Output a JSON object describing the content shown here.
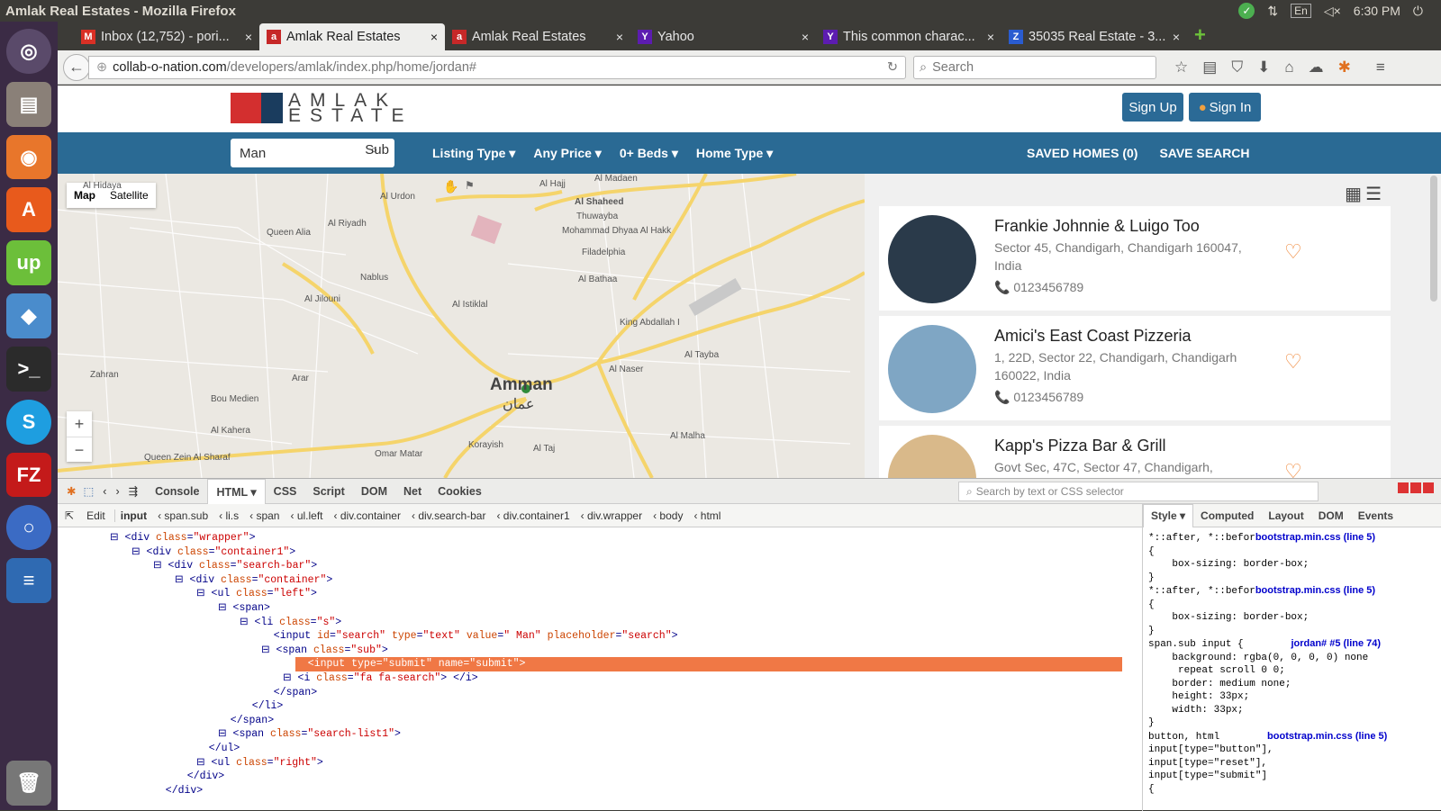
{
  "window": {
    "title": "Amlak Real Estates - Mozilla Firefox",
    "lang": "En",
    "time": "6:30 PM"
  },
  "tabs": [
    {
      "label": "Inbox (12,752) - pori...",
      "icon": "gmail-icon",
      "active": false
    },
    {
      "label": "Amlak Real Estates",
      "icon": "amlak-icon",
      "active": true
    },
    {
      "label": "Amlak Real Estates",
      "icon": "amlak-icon",
      "active": false
    },
    {
      "label": "Yahoo",
      "icon": "yahoo-icon",
      "active": false
    },
    {
      "label": "This common charac...",
      "icon": "yahoo-icon",
      "active": false
    },
    {
      "label": "35035 Real Estate - 3...",
      "icon": "site-icon",
      "active": false
    }
  ],
  "url": {
    "host": "collab-o-nation.com",
    "path": "/developers/amlak/index.php/home/jordan#"
  },
  "search_placeholder": "Search",
  "site": {
    "logo_top": "AMLAK",
    "logo_bottom": "ESTATE",
    "signup": "Sign Up",
    "signin": "Sign In",
    "search_value": "Man",
    "search_sub": "Sub",
    "filters": [
      "Listing Type",
      "Any Price",
      "0+ Beds",
      "Home Type"
    ],
    "saved_homes": "SAVED HOMES (0)",
    "save_search": "SAVE SEARCH"
  },
  "map": {
    "type_map": "Map",
    "type_satellite": "Satellite",
    "city": "Amman",
    "city_ar": "عمان",
    "labels": [
      "Al Hidaya",
      "Queen Alia",
      "Al Riyadh",
      "Al Urdon",
      "Al Hajj",
      "Al Madaen",
      "Al Shaheed",
      "Thuwayba",
      "Mohammad Dhyaa Al Hakk",
      "Filadelphia",
      "Al Bathaa",
      "Al Istiklal",
      "King Abdallah I",
      "Nablus",
      "Al Jilouni",
      "Zahran",
      "Arar",
      "Bou Medien",
      "Al Kahera",
      "Omar Matar",
      "Queen Zein Al Sharaf",
      "Al Naser",
      "Al Tayba",
      "Korayish",
      "Al Taj",
      "Al Malha"
    ]
  },
  "listings": [
    {
      "name": "Frankie Johnnie & Luigo Too",
      "address": "Sector 45, Chandigarh, Chandigarh 160047, India",
      "phone": "0123456789",
      "img": "#2a3a4a"
    },
    {
      "name": "Amici's East Coast Pizzeria",
      "address": "1, 22D, Sector 22, Chandigarh, Chandigarh 160022, India",
      "phone": "0123456789",
      "img": "#7fa6c4"
    },
    {
      "name": "Kapp's Pizza Bar & Grill",
      "address": "Govt Sec, 47C, Sector 47, Chandigarh,",
      "phone": "",
      "img": "#d9b98a"
    }
  ],
  "devtools": {
    "tabs": [
      "Console",
      "HTML",
      "CSS",
      "Script",
      "DOM",
      "Net",
      "Cookies"
    ],
    "search_placeholder": "Search by text or CSS selector",
    "edit": "Edit",
    "breadcrumbs": [
      "input",
      "span.sub",
      "li.s",
      "span",
      "ul.left",
      "div.container",
      "div.search-bar",
      "div.container1",
      "div.wrapper",
      "body",
      "html"
    ],
    "side_tabs": [
      "Style",
      "Computed",
      "Layout",
      "DOM",
      "Events"
    ],
    "tree": [
      {
        "indent": 0,
        "t": "<div class=\"wrapper\">"
      },
      {
        "indent": 1,
        "t": "<div class=\"container1\">"
      },
      {
        "indent": 2,
        "t": "<div class=\"search-bar\">"
      },
      {
        "indent": 3,
        "t": "<div class=\"container\">"
      },
      {
        "indent": 4,
        "t": "<ul class=\"left\">"
      },
      {
        "indent": 5,
        "t": "<span>"
      },
      {
        "indent": 6,
        "t": "<li class=\"s\">"
      },
      {
        "indent": 7,
        "t": "<input id=\"search\" type=\"text\" value=\" Man\" placeholder=\"search\">"
      },
      {
        "indent": 7,
        "t": "<span class=\"sub\">"
      },
      {
        "indent": 8,
        "t": "<input type=\"submit\" name=\"submit\">",
        "hl": true
      },
      {
        "indent": 8,
        "t": "<i class=\"fa fa-search\"> </i>"
      },
      {
        "indent": 7,
        "t": "</span>"
      },
      {
        "indent": 6,
        "t": "</li>"
      },
      {
        "indent": 5,
        "t": "</span>"
      },
      {
        "indent": 5,
        "t": "<span class=\"search-list1\">"
      },
      {
        "indent": 4,
        "t": "</ul>"
      },
      {
        "indent": 4,
        "t": "<ul class=\"right\">"
      },
      {
        "indent": 3,
        "t": "</div>"
      },
      {
        "indent": 2,
        "t": "</div>"
      }
    ],
    "css": "*::after, *::befor|bootstrap.min.css (line 5)\n{\n    box-sizing: border-box;\n}\n*::after, *::befor|bootstrap.min.css (line 5)\n{\n    box-sizing: border-box;\n}\nspan.sub input {        |jordan# #5 (line 74)\n    background: rgba(0, 0, 0, 0) none\n     repeat scroll 0 0;\n    border: medium none;\n    height: 33px;\n    width: 33px;\n}\nbutton, html        |bootstrap.min.css (line 5)\ninput[type=\"button\"],\ninput[type=\"reset\"],\ninput[type=\"submit\"]\n{"
  }
}
